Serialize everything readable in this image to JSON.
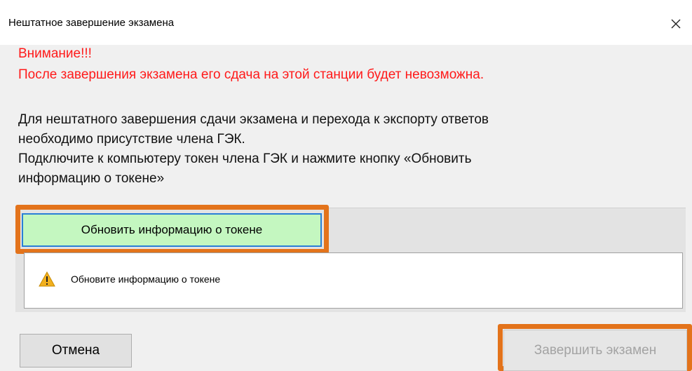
{
  "dialog": {
    "title": "Нештатное завершение экзамена",
    "close_icon": "close-icon"
  },
  "warning": {
    "heading": "Внимание!!!",
    "text": "После завершения экзамена его сдача на этой станции будет невозможна.",
    "color": "#ff1a1a"
  },
  "info": {
    "line1": "Для нештатного завершения сдачи экзамена и перехода к экспорту ответов",
    "line2": "необходимо присутствие члена ГЭК.",
    "line3": "Подключите к компьютеру токен члена ГЭК и нажмите кнопку «Обновить",
    "line4": "информацию о токене»"
  },
  "token": {
    "refresh_label": "Обновить информацию о токене",
    "status_icon": "warning-icon",
    "status_text": "Обновите информацию о токене"
  },
  "buttons": {
    "cancel_label": "Отмена",
    "finish_label": "Завершить экзамен"
  },
  "colors": {
    "highlight": "#e3731b",
    "refresh_bg": "#c4f7c0",
    "refresh_border": "#2a7fd6"
  }
}
